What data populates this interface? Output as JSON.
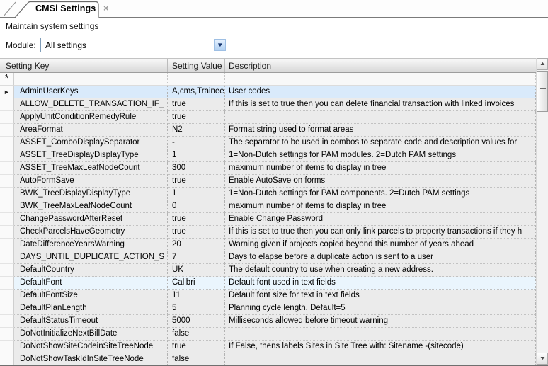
{
  "tab": {
    "title": "CMSi Settings",
    "close_glyph": "×"
  },
  "page": {
    "subtitle": "Maintain system settings"
  },
  "module": {
    "label": "Module:",
    "value": "All settings"
  },
  "colors": {
    "selection_bg": "#d9eafb",
    "hot_row_bg": "#eaf5fd",
    "row_bg": "#ebebeb",
    "combo_border": "#7f9db9",
    "combo_arrow": "#16356e"
  },
  "grid": {
    "headers": {
      "key": "Setting Key",
      "value": "Setting Value",
      "desc": "Description"
    },
    "new_row_glyph": "*",
    "selected_marker_glyph": "►",
    "rows": [
      {
        "key": "AdminUserKeys",
        "value": "A,cms,Trainee",
        "desc": "User codes",
        "state": "selected"
      },
      {
        "key": "ALLOW_DELETE_TRANSACTION_IF_",
        "value": "true",
        "desc": "If this is set to true then you can delete financial transaction with linked invoices",
        "state": ""
      },
      {
        "key": "ApplyUnitConditionRemedyRule",
        "value": "true",
        "desc": "",
        "state": ""
      },
      {
        "key": "AreaFormat",
        "value": "N2",
        "desc": "Format string used to format areas",
        "state": ""
      },
      {
        "key": "ASSET_ComboDisplaySeparator",
        "value": "-",
        "desc": "The separator to be used in combos to separate code and description values for",
        "state": ""
      },
      {
        "key": "ASSET_TreeDisplayDisplayType",
        "value": "1",
        "desc": "1=Non-Dutch settings for PAM modules. 2=Dutch PAM settings",
        "state": ""
      },
      {
        "key": "ASSET_TreeMaxLeafNodeCount",
        "value": "300",
        "desc": "maximum number of items to display in tree",
        "state": ""
      },
      {
        "key": "AutoFormSave",
        "value": "true",
        "desc": "Enable AutoSave on forms",
        "state": ""
      },
      {
        "key": "BWK_TreeDisplayDisplayType",
        "value": "1",
        "desc": "1=Non-Dutch settings for PAM components. 2=Dutch PAM settings",
        "state": ""
      },
      {
        "key": "BWK_TreeMaxLeafNodeCount",
        "value": "0",
        "desc": "maximum number of items to display in tree",
        "state": ""
      },
      {
        "key": "ChangePasswordAfterReset",
        "value": "true",
        "desc": "Enable Change Password",
        "state": ""
      },
      {
        "key": "CheckParcelsHaveGeometry",
        "value": "true",
        "desc": "If this is set to true then you can only link parcels to property transactions if they h",
        "state": ""
      },
      {
        "key": "DateDifferenceYearsWarning",
        "value": "20",
        "desc": "Warning given if projects copied beyond this number of years ahead",
        "state": ""
      },
      {
        "key": "DAYS_UNTIL_DUPLICATE_ACTION_S",
        "value": "7",
        "desc": "Days to elapse before a duplicate action is sent to a user",
        "state": ""
      },
      {
        "key": "DefaultCountry",
        "value": "UK",
        "desc": "The default country to use when creating a new address.",
        "state": ""
      },
      {
        "key": "DefaultFont",
        "value": "Calibri",
        "desc": "Default font used in text fields",
        "state": "hot"
      },
      {
        "key": "DefaultFontSize",
        "value": "11",
        "desc": "Default font size for text in text fields",
        "state": ""
      },
      {
        "key": "DefaultPlanLength",
        "value": "5",
        "desc": "Planning cycle length. Default=5",
        "state": ""
      },
      {
        "key": "DefaultStatusTimeout",
        "value": "5000",
        "desc": "Milliseconds allowed before timeout warning",
        "state": ""
      },
      {
        "key": "DoNotInitializeNextBillDate",
        "value": "false",
        "desc": "",
        "state": ""
      },
      {
        "key": "DoNotShowSiteCodeinSiteTreeNode",
        "value": "true",
        "desc": "If False, thens labels Sites in Site Tree with: Sitename -(sitecode)",
        "state": ""
      },
      {
        "key": "DoNotShowTaskIdInSiteTreeNode",
        "value": "false",
        "desc": "",
        "state": ""
      }
    ]
  }
}
